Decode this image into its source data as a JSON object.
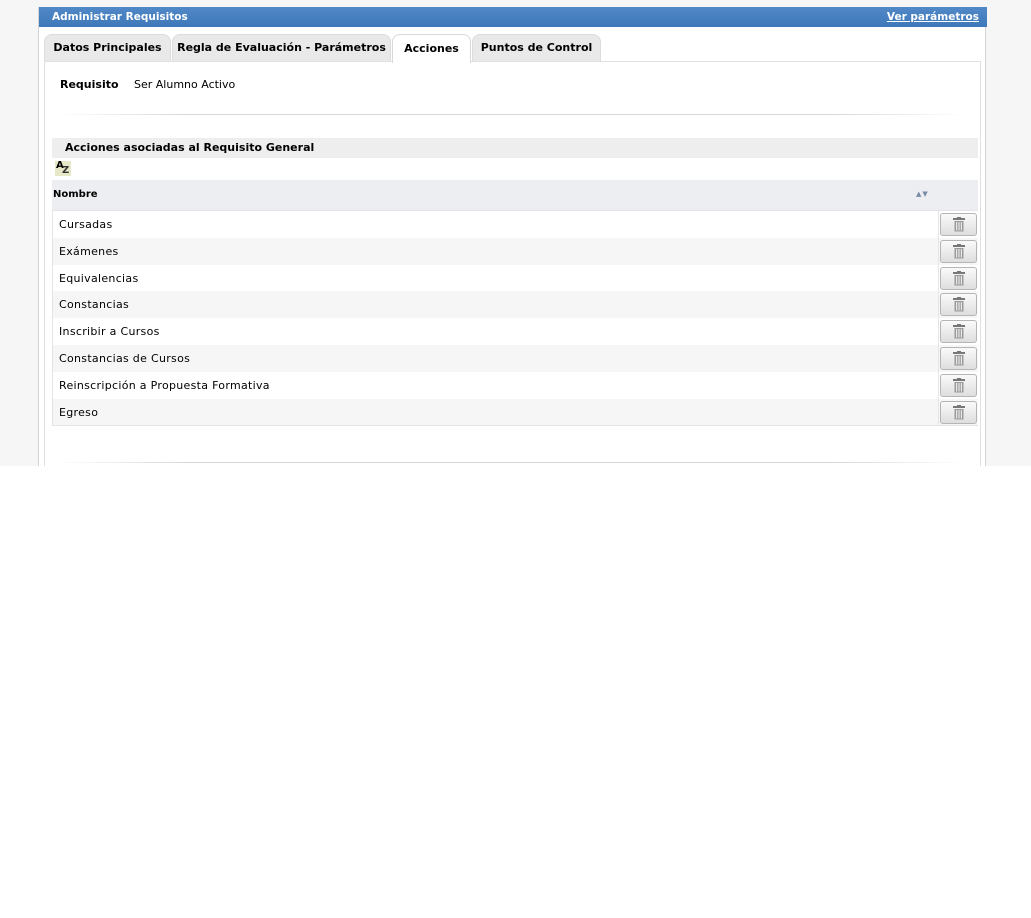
{
  "header": {
    "title": "Administrar Requisitos",
    "link": "Ver parámetros"
  },
  "tabs": [
    {
      "label": "Datos Principales",
      "active": false
    },
    {
      "label": "Regla de Evaluación - Parámetros",
      "active": false
    },
    {
      "label": "Acciones",
      "active": true
    },
    {
      "label": "Puntos de Control",
      "active": false
    }
  ],
  "requisito": {
    "label": "Requisito",
    "value": "Ser Alumno Activo"
  },
  "section": {
    "title": "Acciones asociadas al Requisito General"
  },
  "table": {
    "column_name": "Nombre",
    "rows": [
      "Cursadas",
      "Exámenes",
      "Equivalencias",
      "Constancias",
      "Inscribir a Cursos",
      "Constancias de Cursos",
      "Reinscripción a Propuesta Formativa",
      "Egreso"
    ]
  },
  "icons": {
    "sort": "sort-asc-desc-icon",
    "az": "sort-az-icon",
    "delete": "trash-icon"
  },
  "colors": {
    "titlebar": "#4a80c0",
    "tab_inactive": "#e9e9e9",
    "header_row": "#eceef2"
  }
}
